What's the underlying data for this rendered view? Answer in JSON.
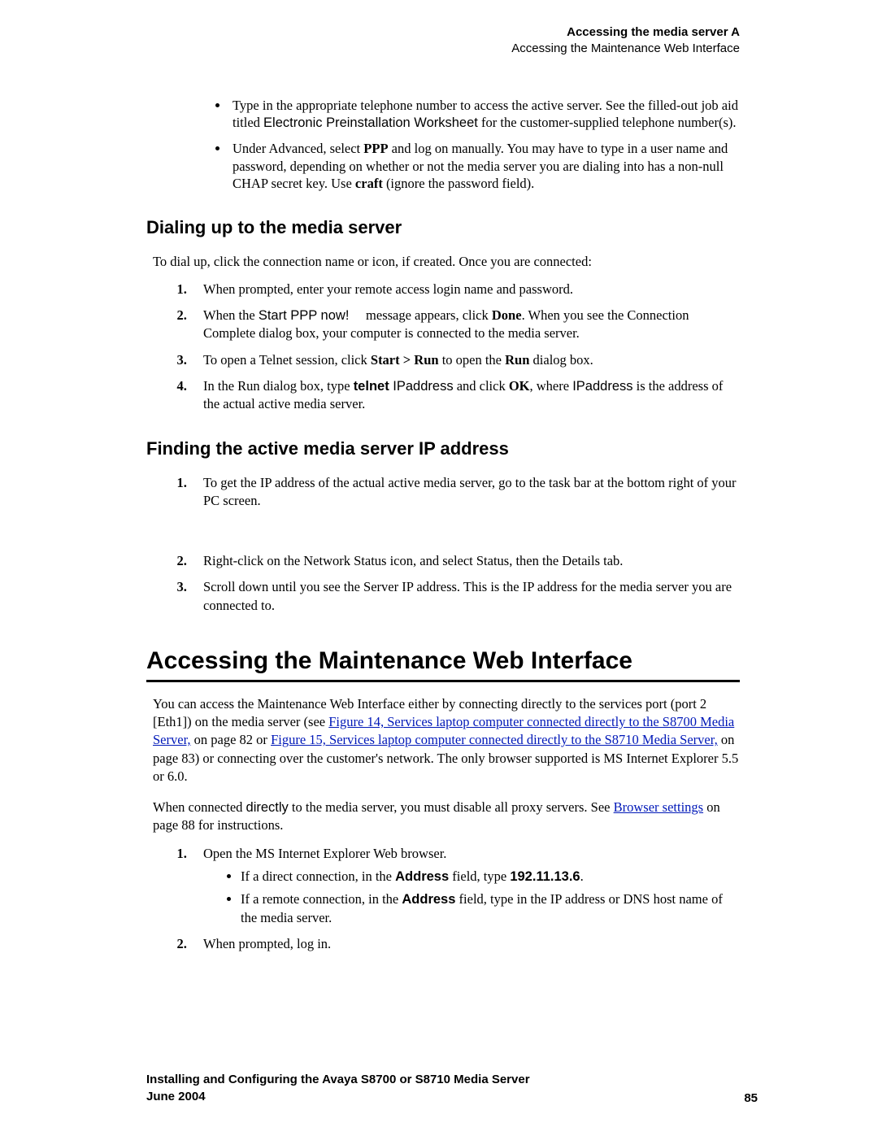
{
  "header": {
    "line1": "Accessing the media server A",
    "line2": "Accessing the Maintenance Web Interface"
  },
  "topBullets": {
    "item1": {
      "pre": "Type in the appropriate telephone number to access the active server. See the filled-out job aid titled ",
      "sans": "Electronic Preinstallation Worksheet",
      "post": " for the customer-supplied telephone number(s)."
    },
    "item2": {
      "a": "Under Advanced, select ",
      "b": "PPP",
      "c": " and log on manually. You may have to type in a user name and password, depending on whether or not the media server you are dialing into has a non-null CHAP secret key. Use ",
      "d": "craft",
      "e": " (ignore the password field)."
    }
  },
  "section1": {
    "title": "Dialing up to the media server",
    "intro": "To dial up, click the connection name or icon, if created. Once you are connected:",
    "n1": "When prompted, enter your remote access login name and password.",
    "n2": {
      "a": "When the ",
      "b": "Start PPP now!",
      "c": " message appears, click ",
      "d": "Done",
      "e": ". When you see the Connection Complete dialog box, your computer is connected to the media server."
    },
    "n3": {
      "a": "To open a Telnet session, click ",
      "b": "Start > Run",
      "c": " to open the ",
      "d": "Run",
      "e": " dialog box."
    },
    "n4": {
      "a": "In the Run dialog box, type ",
      "b": "telnet ",
      "c": "IPaddress",
      "d": " and click ",
      "e": "OK",
      "f": ", where ",
      "g": "IPaddress",
      "h": " is the address of the actual active media server."
    }
  },
  "section2": {
    "title": "Finding the active media server IP address",
    "n1": "To get the IP address of the actual active media server, go to the task bar at the bottom right of your PC screen.",
    "n2": "Right-click on the Network Status icon, and select Status, then the Details tab.",
    "n3": "Scroll down until you see the Server IP address. This is the IP address for the media server you are connected to."
  },
  "major": {
    "title": "Accessing the Maintenance Web Interface",
    "p1": {
      "a": "You can access the Maintenance Web Interface either by connecting directly to the services port (port 2 [Eth1]) on the media server (see ",
      "link1": "Figure 14, Services laptop computer connected directly to the S8700 Media Server,",
      "b": " on page 82 or ",
      "link2": "Figure 15, Services laptop computer connected directly to the S8710 Media Server,",
      "c": " on page 83) or connecting over the customer's network. The only browser supported is MS Internet Explorer 5.5 or 6.0."
    },
    "p2": {
      "a": "When connected ",
      "b": "directly",
      "c": " to the media server, you must disable all proxy servers. See ",
      "link": "Browser settings",
      "d": " on page 88 for instructions."
    },
    "n1": {
      "text": "Open the MS Internet Explorer Web browser.",
      "sub1": {
        "a": "If a direct connection, in the ",
        "b": "Address",
        "c": " field, type ",
        "d": "192.11.13.6",
        "e": "."
      },
      "sub2": {
        "a": "If a remote connection, in the ",
        "b": "Address",
        "c": " field, type in the IP address or DNS host name of the media server."
      }
    },
    "n2": "When prompted, log in."
  },
  "footer": {
    "title": "Installing and Configuring the Avaya S8700 or S8710 Media Server",
    "date": "June 2004",
    "page": "85"
  }
}
